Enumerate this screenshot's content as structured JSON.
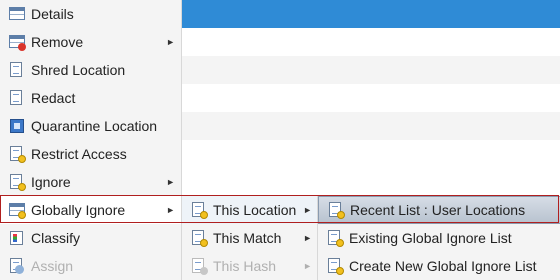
{
  "main_menu": {
    "items": [
      {
        "label": "Details",
        "icon": "details-icon",
        "has_submenu": false
      },
      {
        "label": "Remove",
        "icon": "remove-icon",
        "has_submenu": true
      },
      {
        "label": "Shred Location",
        "icon": "shred-location-icon",
        "has_submenu": false
      },
      {
        "label": "Redact",
        "icon": "redact-icon",
        "has_submenu": false
      },
      {
        "label": "Quarantine Location",
        "icon": "quarantine-icon",
        "has_submenu": false
      },
      {
        "label": "Restrict Access",
        "icon": "restrict-access-icon",
        "has_submenu": false
      },
      {
        "label": "Ignore",
        "icon": "ignore-icon",
        "has_submenu": true
      },
      {
        "label": "Globally Ignore",
        "icon": "globally-ignore-icon",
        "has_submenu": true,
        "highlighted": true
      },
      {
        "label": "Classify",
        "icon": "classify-icon",
        "has_submenu": false
      },
      {
        "label": "Assign",
        "icon": "assign-icon",
        "has_submenu": false,
        "disabled": true
      }
    ]
  },
  "submenu_globally_ignore": {
    "items": [
      {
        "label": "This Location",
        "has_submenu": true,
        "highlighted": true
      },
      {
        "label": "This Match",
        "has_submenu": true
      },
      {
        "label": "This Hash",
        "has_submenu": true,
        "disabled": true
      }
    ]
  },
  "submenu_this_location": {
    "items": [
      {
        "label": "Recent List : User Locations",
        "highlighted": true
      },
      {
        "label": "Existing Global Ignore List"
      },
      {
        "label": "Create New Global Ignore List"
      }
    ]
  },
  "colors": {
    "header_blue": "#2f8bd6",
    "menu_bg": "#f4f4f4",
    "highlight_border": "#b01f1f",
    "disabled_text": "#b0b0b0"
  },
  "submenu_arrow": "►"
}
